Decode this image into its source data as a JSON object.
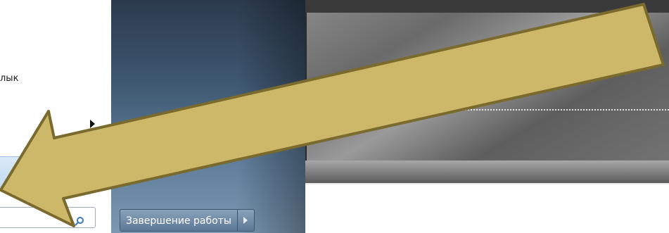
{
  "start_menu": {
    "left_item_text": "лык",
    "shutdown_label": "Завершение работы"
  },
  "colors": {
    "arrow_fill": "#cdb86a",
    "arrow_stroke": "#7a6a2e",
    "mid_panel": "#4a6480",
    "desktop_dark": "#6a6a6a"
  },
  "icons": {
    "search": "magnifier-icon",
    "submenu": "triangle-right-icon",
    "shutdown_options": "triangle-right-icon",
    "annotation": "big-arrow-icon"
  }
}
